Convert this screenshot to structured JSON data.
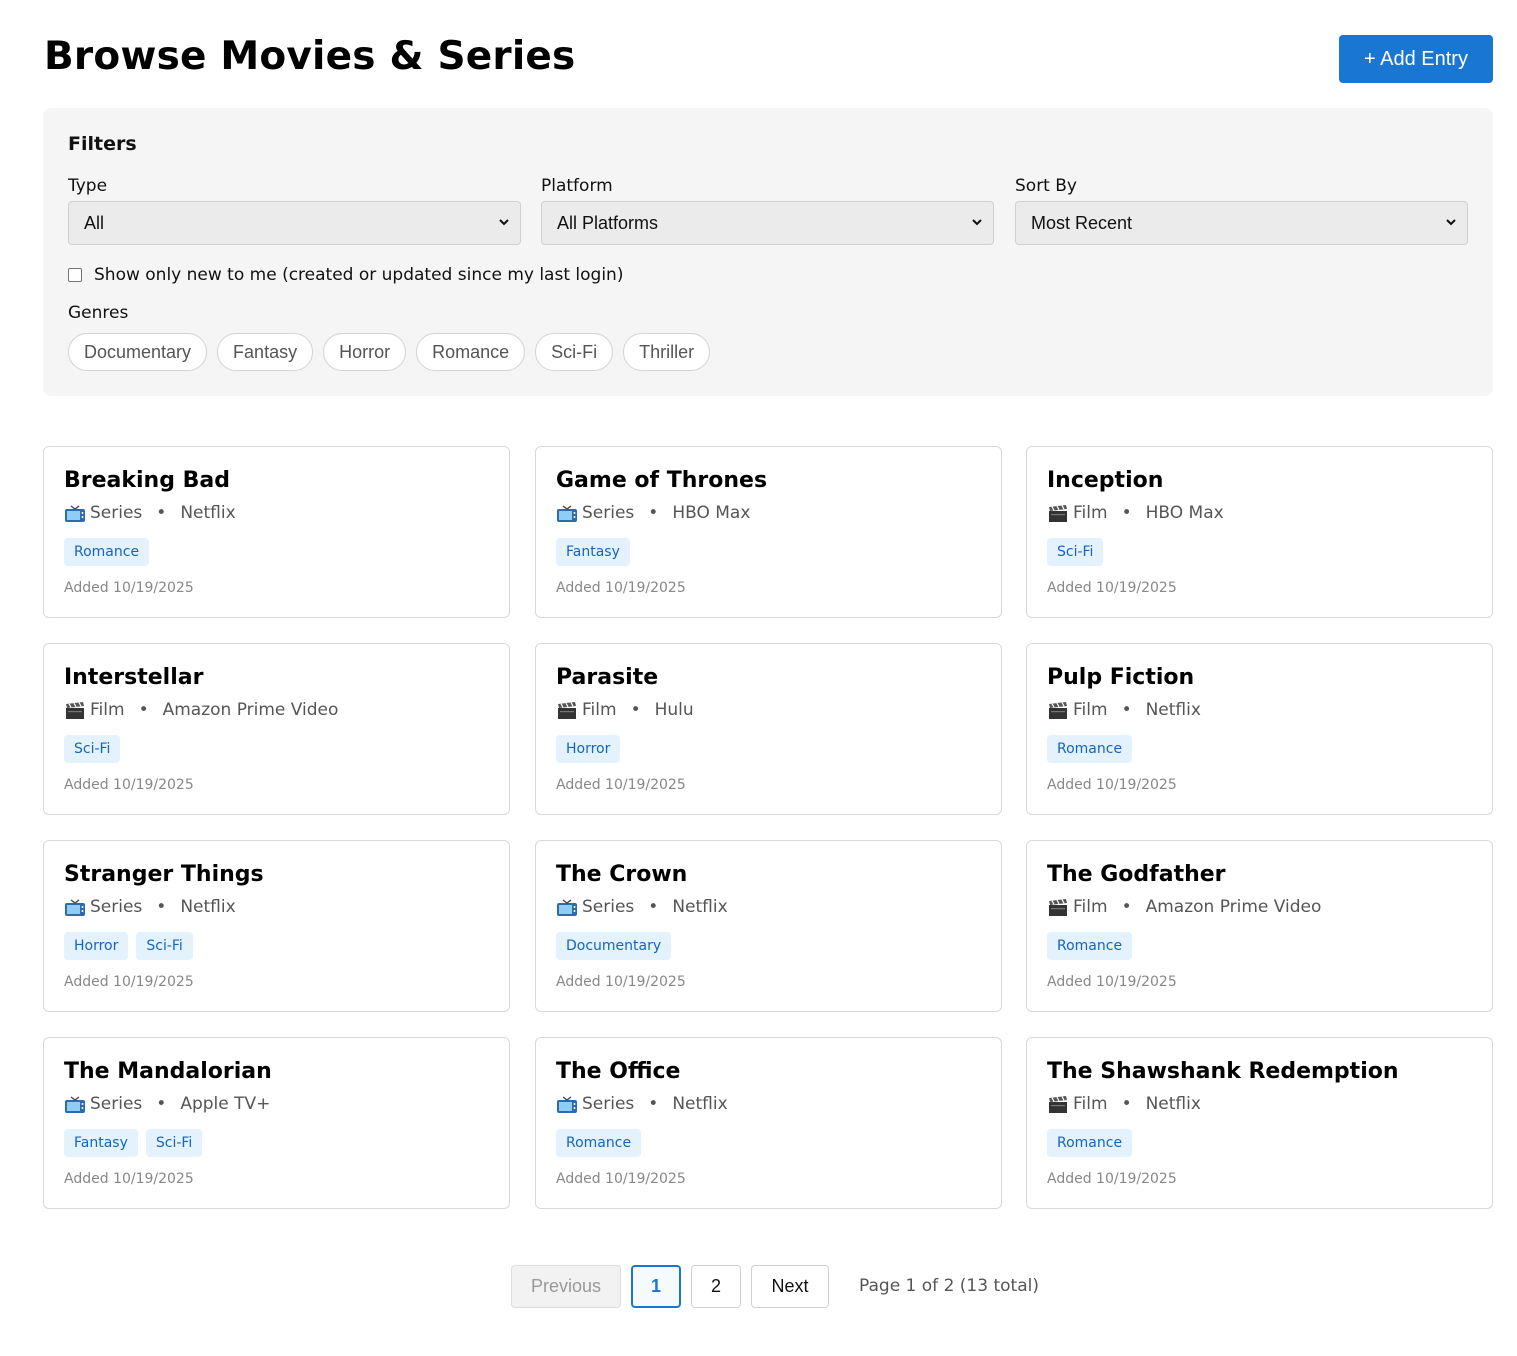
{
  "header": {
    "title": "Browse Movies & Series",
    "add_button": "+ Add Entry"
  },
  "filters": {
    "title": "Filters",
    "type": {
      "label": "Type",
      "value": "All"
    },
    "platform": {
      "label": "Platform",
      "value": "All Platforms"
    },
    "sort": {
      "label": "Sort By",
      "value": "Most Recent"
    },
    "new_only": {
      "label": "Show only new to me (created or updated since my last login)",
      "checked": false
    },
    "genres_label": "Genres",
    "genres": [
      "Documentary",
      "Fantasy",
      "Horror",
      "Romance",
      "Sci-Fi",
      "Thriller"
    ]
  },
  "entries": [
    {
      "title": "Breaking Bad",
      "type": "Series",
      "icon": "tv-icon",
      "platform": "Netflix",
      "genres": [
        "Romance"
      ],
      "added": "Added 10/19/2025"
    },
    {
      "title": "Game of Thrones",
      "type": "Series",
      "icon": "tv-icon",
      "platform": "HBO Max",
      "genres": [
        "Fantasy"
      ],
      "added": "Added 10/19/2025"
    },
    {
      "title": "Inception",
      "type": "Film",
      "icon": "clapperboard-icon",
      "platform": "HBO Max",
      "genres": [
        "Sci-Fi"
      ],
      "added": "Added 10/19/2025"
    },
    {
      "title": "Interstellar",
      "type": "Film",
      "icon": "clapperboard-icon",
      "platform": "Amazon Prime Video",
      "genres": [
        "Sci-Fi"
      ],
      "added": "Added 10/19/2025"
    },
    {
      "title": "Parasite",
      "type": "Film",
      "icon": "clapperboard-icon",
      "platform": "Hulu",
      "genres": [
        "Horror"
      ],
      "added": "Added 10/19/2025"
    },
    {
      "title": "Pulp Fiction",
      "type": "Film",
      "icon": "clapperboard-icon",
      "platform": "Netflix",
      "genres": [
        "Romance"
      ],
      "added": "Added 10/19/2025"
    },
    {
      "title": "Stranger Things",
      "type": "Series",
      "icon": "tv-icon",
      "platform": "Netflix",
      "genres": [
        "Horror",
        "Sci-Fi"
      ],
      "added": "Added 10/19/2025"
    },
    {
      "title": "The Crown",
      "type": "Series",
      "icon": "tv-icon",
      "platform": "Netflix",
      "genres": [
        "Documentary"
      ],
      "added": "Added 10/19/2025"
    },
    {
      "title": "The Godfather",
      "type": "Film",
      "icon": "clapperboard-icon",
      "platform": "Amazon Prime Video",
      "genres": [
        "Romance"
      ],
      "added": "Added 10/19/2025"
    },
    {
      "title": "The Mandalorian",
      "type": "Series",
      "icon": "tv-icon",
      "platform": "Apple TV+",
      "genres": [
        "Fantasy",
        "Sci-Fi"
      ],
      "added": "Added 10/19/2025"
    },
    {
      "title": "The Office",
      "type": "Series",
      "icon": "tv-icon",
      "platform": "Netflix",
      "genres": [
        "Romance"
      ],
      "added": "Added 10/19/2025"
    },
    {
      "title": "The Shawshank Redemption",
      "type": "Film",
      "icon": "clapperboard-icon",
      "platform": "Netflix",
      "genres": [
        "Romance"
      ],
      "added": "Added 10/19/2025"
    }
  ],
  "pagination": {
    "previous": "Previous",
    "pages": [
      "1",
      "2"
    ],
    "current": "1",
    "next": "Next",
    "info": "Page 1 of 2 (13 total)"
  },
  "colors": {
    "primary": "#1976d2",
    "tag_bg": "#e3f2fd",
    "tag_text": "#1565c0",
    "panel_bg": "#f5f5f5"
  }
}
